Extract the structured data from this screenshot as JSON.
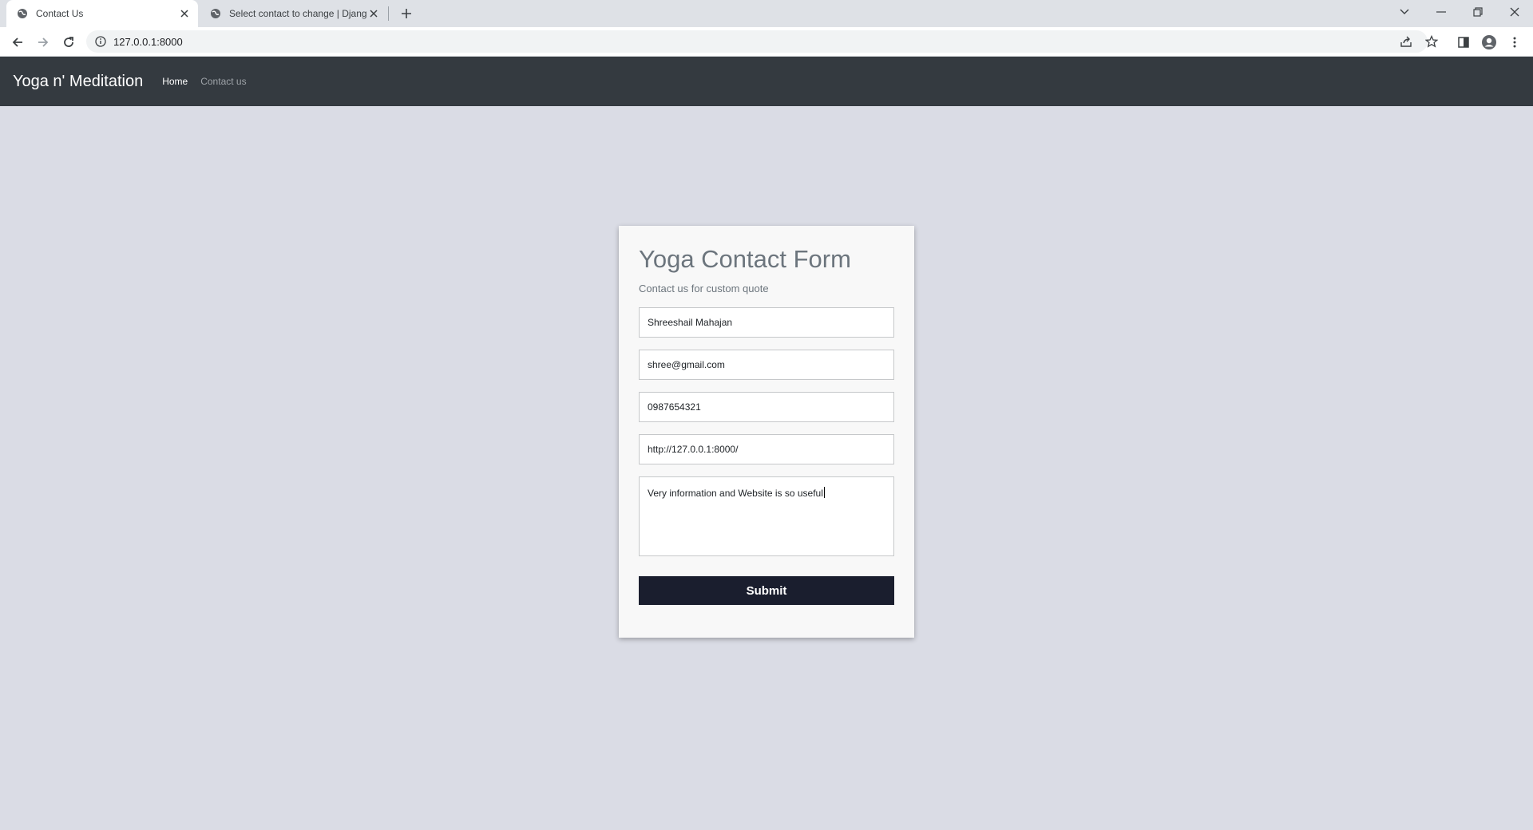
{
  "browser": {
    "tabs": [
      {
        "title": "Contact Us",
        "active": true
      },
      {
        "title": "Select contact to change | Django",
        "active": false
      }
    ],
    "url": "127.0.0.1:8000"
  },
  "navbar": {
    "brand": "Yoga n' Meditation",
    "links": [
      "Home",
      "Contact us"
    ]
  },
  "form": {
    "title": "Yoga Contact Form",
    "subtitle": "Contact us for custom quote",
    "name": "Shreeshail Mahajan",
    "email": "shree@gmail.com",
    "phone": "0987654321",
    "website": "http://127.0.0.1:8000/",
    "message": "Very information and Website is so useful",
    "submit_label": "Submit"
  },
  "colors": {
    "navbar_bg": "#343a40",
    "page_bg": "#dadce5",
    "submit_bg": "#1a1e2e"
  },
  "icons": [
    "globe-icon",
    "close-icon",
    "plus-icon",
    "chevron-down-icon",
    "minimize-icon",
    "restore-icon",
    "back-arrow-icon",
    "forward-arrow-icon",
    "reload-icon",
    "info-icon",
    "share-icon",
    "star-icon",
    "side-panel-icon",
    "profile-icon",
    "kebab-menu-icon"
  ]
}
